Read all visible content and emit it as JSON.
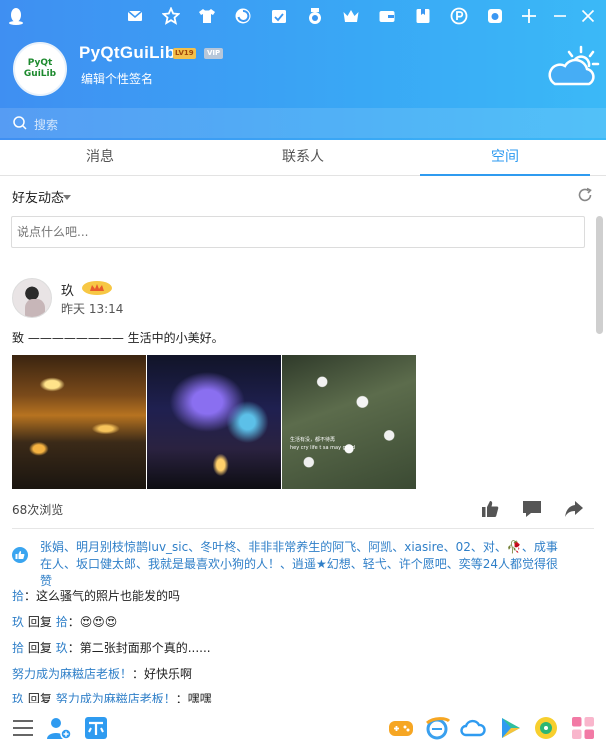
{
  "app": {
    "nickname": "PyQtGuiLib",
    "level_badge": "LV19",
    "vip_badge": "VIP",
    "signature": "编辑个性签名",
    "avatar_text_line1": "PyQt",
    "avatar_text_line2": "GuiLib"
  },
  "search": {
    "placeholder": "搜索"
  },
  "tabs": [
    {
      "label": "消息"
    },
    {
      "label": "联系人"
    },
    {
      "label": "空间"
    }
  ],
  "feed": {
    "title": "好友动态",
    "input_placeholder": "说点什么吧..."
  },
  "post": {
    "author": "玖",
    "time": "昨天 13:14",
    "text": "致 ———————— 生活中的小美好。",
    "photo3_caption_line1": "生活有没，都不待再",
    "photo3_caption_line2": "hey cry  life  t  sa  may  good",
    "views": "68次浏览",
    "likers_text": "张娟、明月别枝惊鹊luv_sic、冬叶柊、非非非常养生的阿飞、阿凯、xiasire、02、对、🥀、成事在人、坂口健太郎、我就是最喜欢小狗的人！、逍遥★幻想、轻弋、许个愿吧、奕等24人都觉得很赞"
  },
  "comments": [
    {
      "user": "拾",
      "reply_to": "",
      "text": "这么骚气的照片也能发的吗"
    },
    {
      "user": "玖",
      "reply_to": "拾",
      "text": "😍😍😍"
    },
    {
      "user": "拾",
      "reply_to": "玖",
      "text": "第二张封面那个真的......"
    },
    {
      "user": "努力成为麻糍店老板！",
      "reply_to": "",
      "text": "好快乐啊"
    },
    {
      "user": "玖",
      "reply_to": "努力成为麻糍店老板！",
      "text": "嘿嘿"
    }
  ],
  "labels": {
    "reply": "回复",
    "colon": "："
  },
  "colors": {
    "header_start": "#3f8ff2",
    "header_end": "#3bb9f7",
    "accent": "#2f9bf0",
    "link": "#2f7fc8"
  },
  "icons": {
    "topbar": [
      "mail-icon",
      "star-icon",
      "shirt-icon",
      "swirl-icon",
      "calendar-icon",
      "medal-icon",
      "crown-icon",
      "wallet-icon",
      "bookmark-icon",
      "p-icon",
      "camera-icon",
      "plus-icon",
      "minimize-icon",
      "close-icon"
    ],
    "bottombar": [
      "menu-icon",
      "add-contact-icon",
      "grid-app-icon",
      "game-icon",
      "browser-icon",
      "cloud-icon",
      "video-icon",
      "music-icon",
      "apps-icon"
    ]
  }
}
